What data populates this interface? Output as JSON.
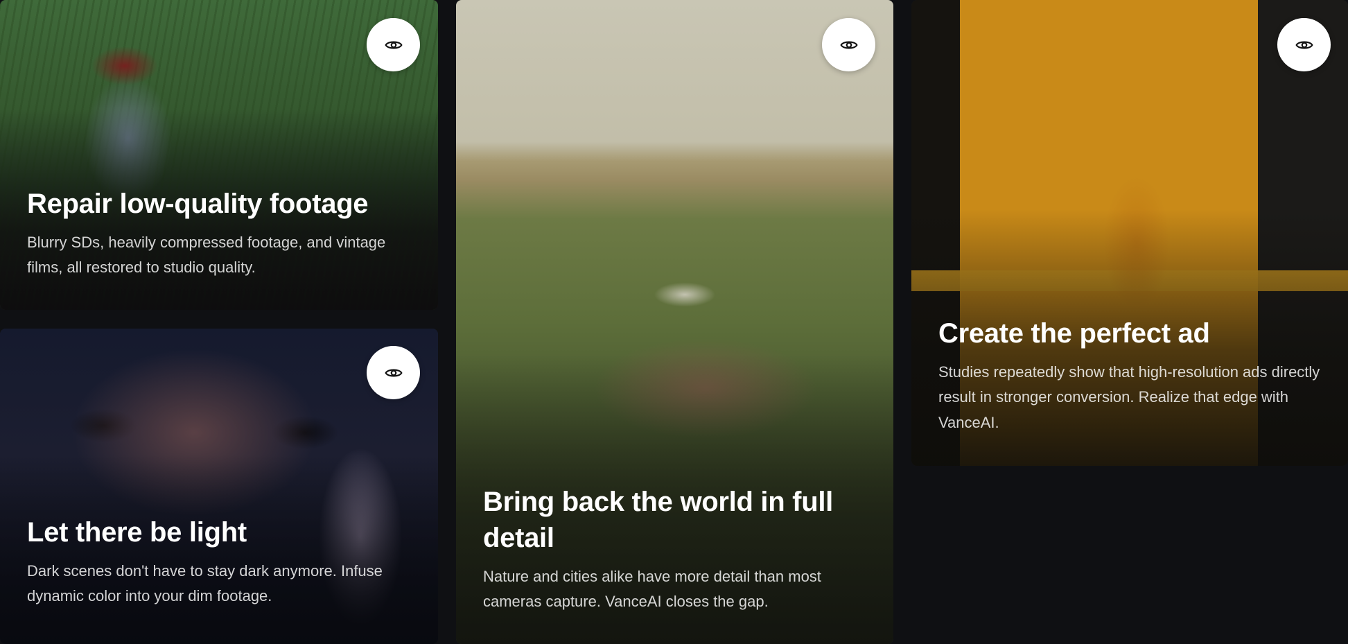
{
  "cards": [
    {
      "title": "Repair low-quality footage",
      "description": "Blurry SDs, heavily compressed footage, and vintage films, all restored to studio quality.",
      "preview_icon": "eye-icon"
    },
    {
      "title": "Let there be light",
      "description": "Dark scenes don't have to stay dark anymore. Infuse dynamic color into your dim footage.",
      "preview_icon": "eye-icon"
    },
    {
      "title": "Bring back the world in full detail",
      "description": "Nature and cities alike have more detail than most cameras capture. VanceAI closes the gap.",
      "preview_icon": "eye-icon"
    },
    {
      "title": "Create the perfect ad",
      "description": "Studies repeatedly show that high-resolution ads directly result in stronger conversion. Realize that edge with VanceAI.",
      "preview_icon": "eye-icon"
    }
  ],
  "colors": {
    "page_background": "#0f1013",
    "button_background": "#ffffff",
    "title_text": "#ffffff"
  }
}
